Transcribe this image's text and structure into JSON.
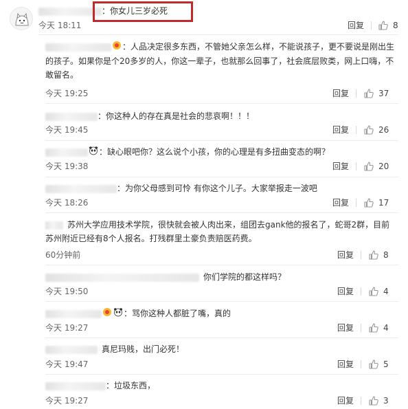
{
  "comments": [
    {
      "text": "：你女儿三岁必死",
      "time": "今天 18:11",
      "reply": "回复",
      "likes": "8"
    },
    {
      "text": "：人品决定很多东西，不管她父亲怎么样，不能说孩子，更不要说是刚出生的孩子。如果你是个20多岁的人，你这一辈子，也就那么回事了，社会底层败类，网上口嗨，不敢留名。",
      "time": "今天 19:25",
      "reply": "回复",
      "likes": "37"
    },
    {
      "text": "：你这种人的存在真是社会的悲哀啊！！！",
      "time": "今天 19:45",
      "reply": "回复",
      "likes": "26"
    },
    {
      "text": "：缺心眼吧你？这么说个小孩，你的心理是有多扭曲变态的啊？",
      "time": "今天 19:38",
      "reply": "回复",
      "likes": "20"
    },
    {
      "text": "：为你父母感到可怜 有你这个儿子。大家举报走一波吧",
      "time": "今天 18:26",
      "reply": "回复",
      "likes": "17"
    },
    {
      "text": "苏州大学应用技术学院，很快就会被人肉出来，组团去gank他的报名了，蛇哥2群，目前苏州附近已经有8个人报名。打残群里土豪负责赔医药费。",
      "time": "60分钟前",
      "reply": "回复",
      "likes": "8"
    },
    {
      "text": "你们学院的都这样吗？",
      "time": "今天 19:50",
      "reply": "回复",
      "likes": "4"
    },
    {
      "text": "：骂你这种人都脏了嘴，真的",
      "time": "今天 19:27",
      "reply": "回复",
      "likes": "4"
    },
    {
      "text": "真尼玛贱，出门必死！",
      "time": "今天 19:47",
      "reply": "回复",
      "likes": "5"
    },
    {
      "text": "：垃圾东西，",
      "time": "今天 19:27",
      "reply": "回复",
      "likes": "3"
    }
  ],
  "colors": {
    "highlight": "#c3282b",
    "like_icon": "#999999"
  }
}
